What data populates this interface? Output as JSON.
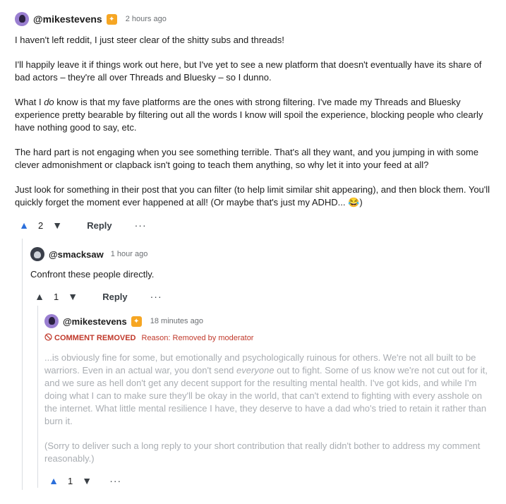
{
  "comments": [
    {
      "username": "@mikestevens",
      "time": "2 hours ago",
      "paragraphs": [
        "I haven't left reddit, I just steer clear of the shitty subs and threads!",
        "I'll happily leave it if things work out here, but I've yet to see a new platform that doesn't eventually have its share of bad actors – they're all over Threads and Bluesky – so I dunno.",
        "What I",
        "do",
        "know is that my fave platforms are the ones with strong filtering. I've made my Threads and Bluesky experience pretty bearable by filtering out all the words I know will spoil the experience, blocking people who clearly have nothing good to say, etc.",
        "The hard part is not engaging when you see something terrible. That's all they want, and you jumping in with some clever admonishment or clapback isn't going to teach them anything, so why let it into your feed at all?",
        "Just look for something in their post that you can filter (to help limit similar shit appearing), and then block them. You'll quickly forget the moment ever happened at all! (Or maybe that's just my ADHD... 😂)"
      ],
      "score": "2",
      "reply_label": "Reply",
      "more": "···"
    },
    {
      "username": "@smacksaw",
      "time": "1 hour ago",
      "text": "Confront these people directly.",
      "score": "1",
      "reply_label": "Reply",
      "more": "···"
    },
    {
      "username": "@mikestevens",
      "time": "18 minutes ago",
      "removed_label": "COMMENT REMOVED",
      "removed_reason": "Reason: Removed by moderator",
      "p1_a": "...is obviously fine for some, but emotionally and psychologically ruinous for others. We're not all built to be warriors. Even in an actual war, you don't send",
      "p1_em": "everyone",
      "p1_b": "out to fight. Some of us know we're not cut out for it, and we sure as hell don't get any decent support for the resulting mental health. I've got kids, and while I'm doing what I can to make sure they'll be okay in the world, that can't extend to fighting with every asshole on the internet. What little mental resilience I have, they deserve to have a dad who's tried to retain it rather than burn it.",
      "p2": "(Sorry to deliver such a long reply to your short contribution that really didn't bother to address my comment reasonably.)",
      "score": "1",
      "more": "···"
    }
  ],
  "icons": {
    "upvote": "▲",
    "downvote": "▼",
    "badge": "✦",
    "removed": "⃠"
  }
}
